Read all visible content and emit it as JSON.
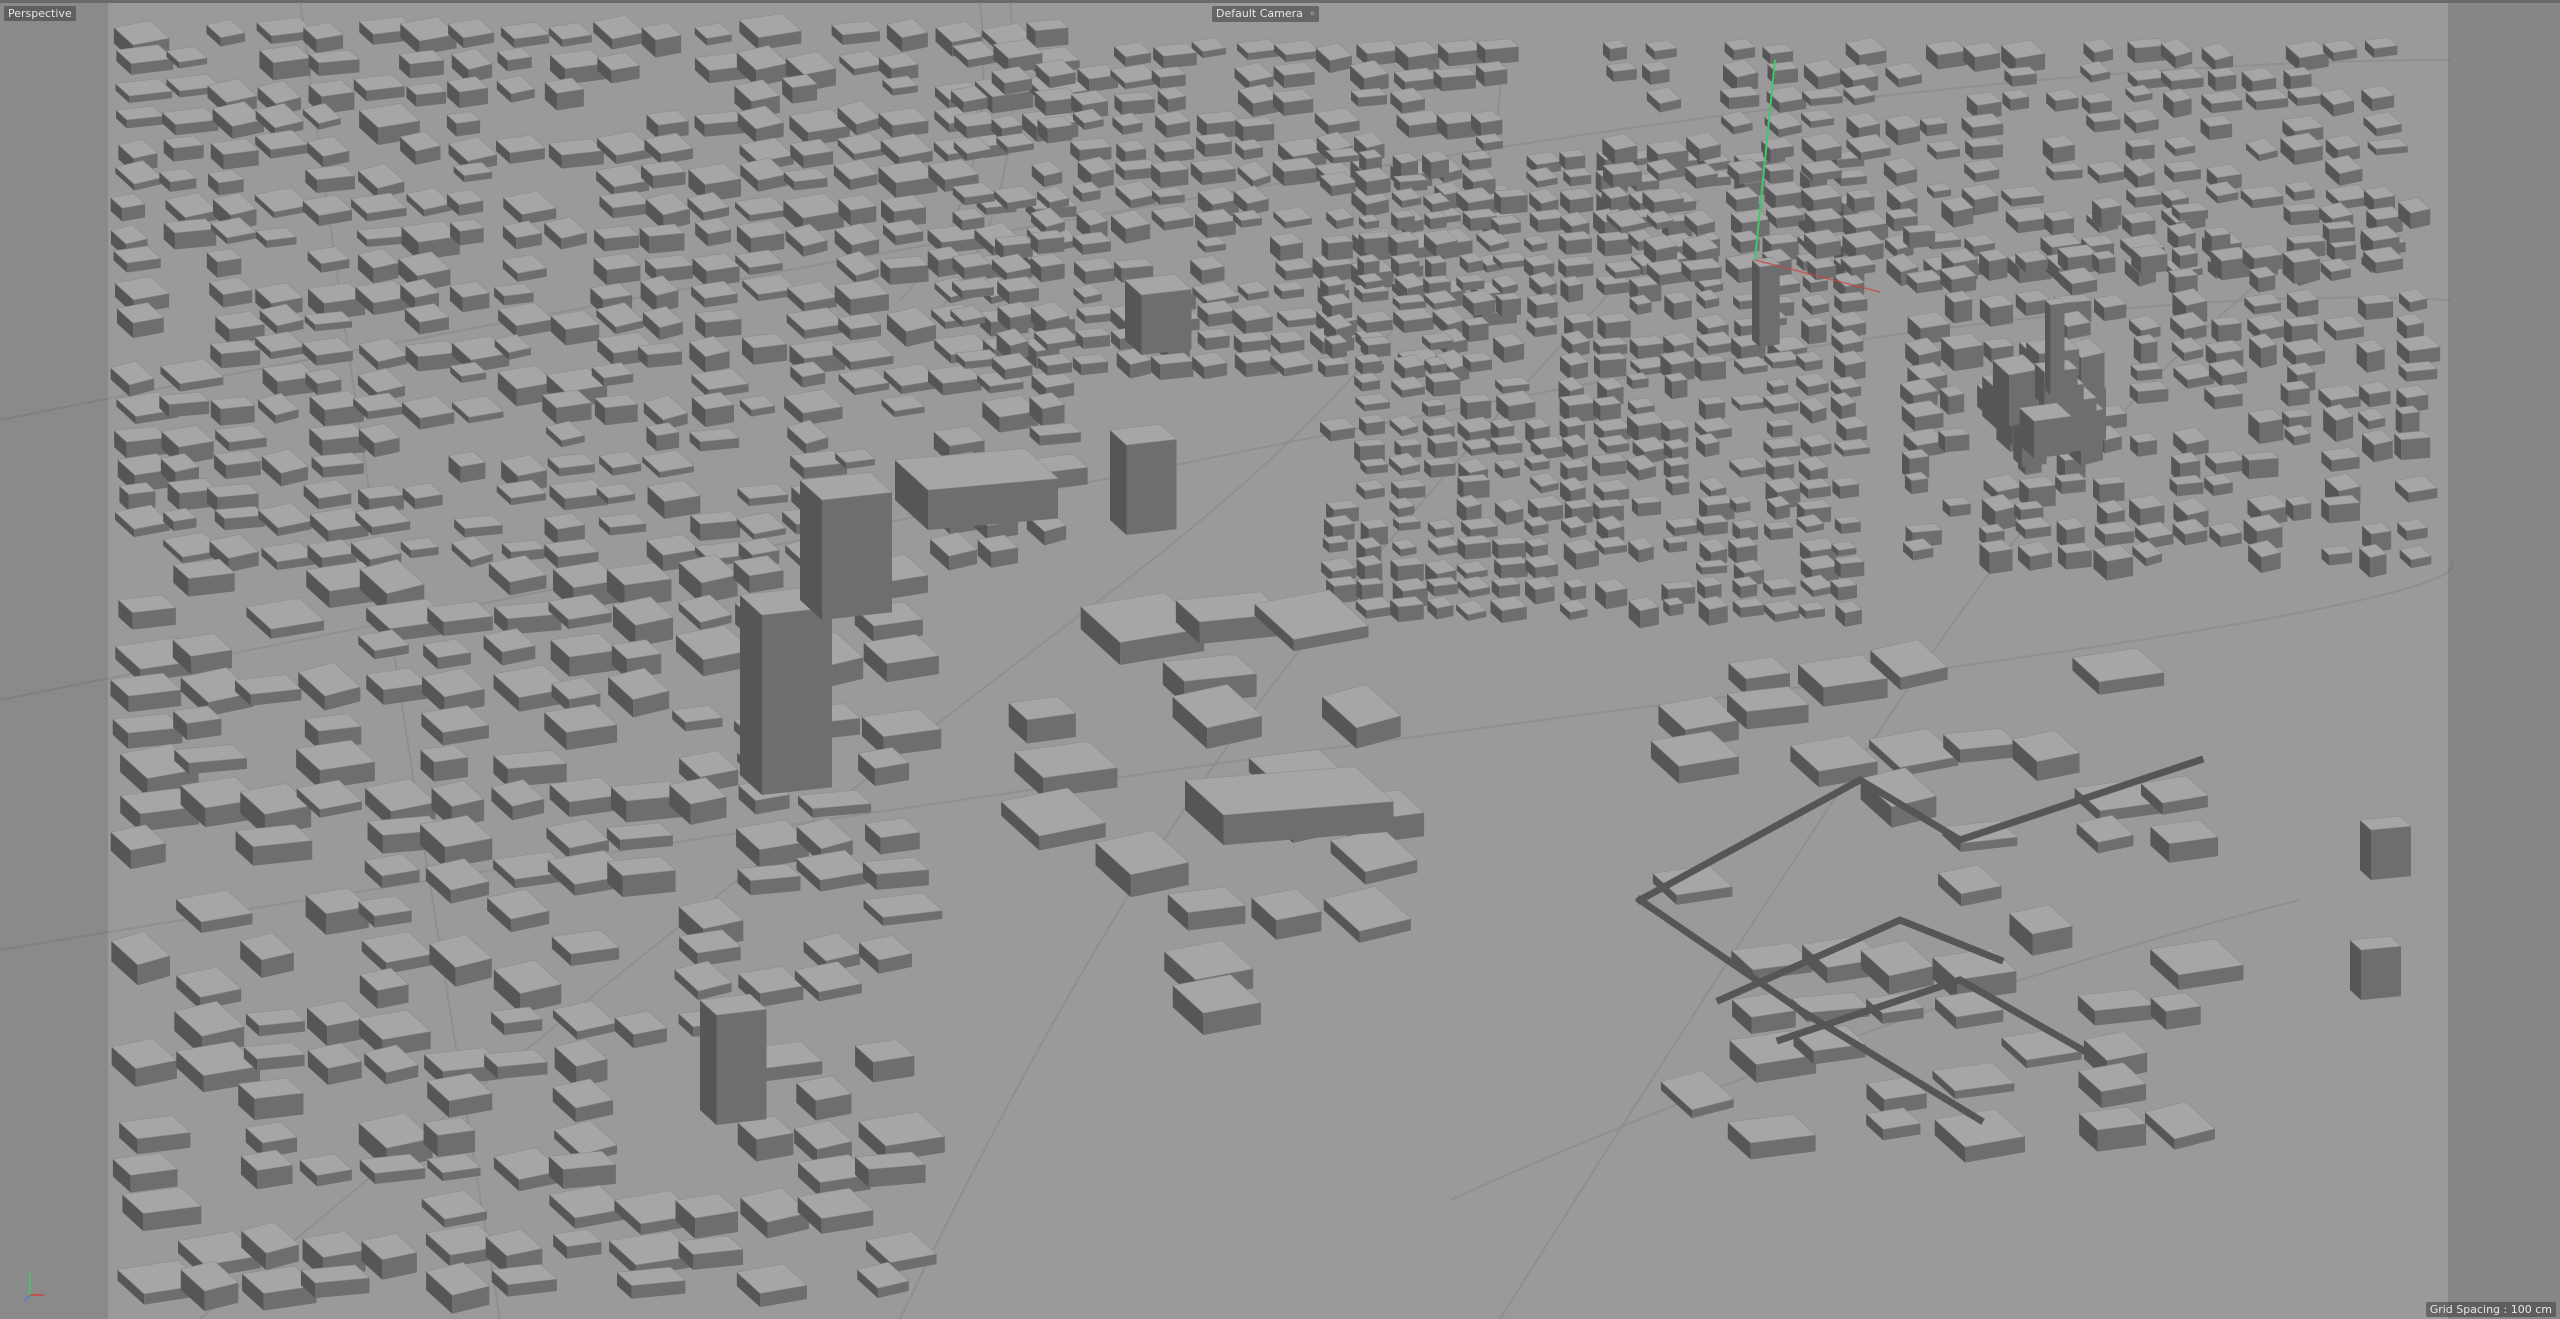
{
  "viewport": {
    "view_label": "Perspective",
    "camera_label": "Default Camera",
    "camera_icon": "camera-toggle-icon",
    "grid_spacing": "Grid Spacing : 100 cm"
  },
  "scene": {
    "description_type": "3D city model viewport",
    "colors": {
      "ground": "#9a9a9a",
      "building_top": "#a6a6a6",
      "building_side": "#6e6e6e",
      "building_dark": "#565656",
      "road_line": "#8a8a8a",
      "y_axis": "#3ec96a",
      "x_axis": "#d04040",
      "z_axis": "#4f7ad6"
    }
  }
}
